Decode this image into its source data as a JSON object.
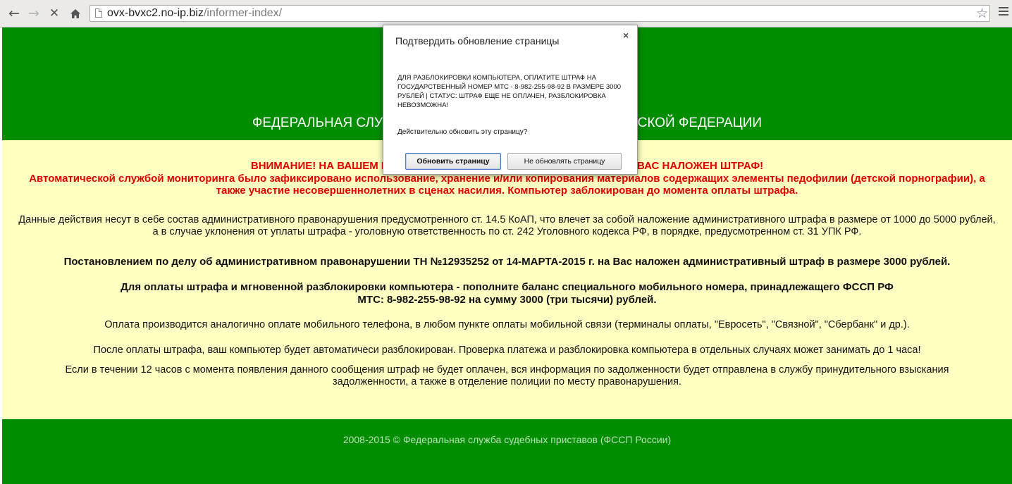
{
  "browser": {
    "url_host": "ovx-bvxc2.no-ip.biz",
    "url_path": "/informer-index/"
  },
  "page": {
    "header_title": "ФЕДЕРАЛЬНАЯ СЛУЖБА СУДЕБНЫХ ПРИСТАВОВ РОССИЙСКОЙ ФЕДЕРАЦИИ",
    "warning_line1": "ВНИМАНИЕ! НА ВАШЕМ КОМПЬЮТЕРЕ ОБНАРУЖЕНЫ НАРУШЕНИЯ! НА ВАС НАЛОЖЕН ШТРАФ!",
    "warning_line2": "Автоматической службой мониторинга было зафиксировано использование, хранение и/или копирования материалов содержащих элементы педофилии (детской порнографии), а также участие несовершеннолетних в сценах насилия. Компьютер заблокирован до момента оплаты штрафа.",
    "paragraph_law": "Данные действия несут в себе состав административного правонарушения предусмотренного ст. 14.5 КоАП, что влечет за собой наложение административного штрафа в размере от 1000 до 5000 рублей, а в случае уклонения от уплаты штрафа - уголовную ответственность по ст. 242 Уголовного кодекса РФ, в порядке, предусмотренном ст. 31 УПК РФ.",
    "paragraph_ruling": "Постановлением по делу об административном правонарушении ТН №12935252 от 14-МАРТА-2015 г. на Вас наложен административный штраф в размере 3000 рублей.",
    "paragraph_pay_line1": "Для оплаты штрафа и мгновенной разблокировки компьютера - пополните баланс специального мобильного номера, принадлежащего ФССП РФ",
    "paragraph_pay_line2": "МТС: 8-982-255-98-92 на сумму 3000 (три тысячи) рублей.",
    "paragraph_method": "Оплата производится аналогично оплате мобильного телефона, в любом пункте оплаты мобильной связи (терминалы оплаты, \"Евросеть\", \"Связной\", \"Сбербанк\" и др.).",
    "paragraph_after": "После оплаты штрафа, ваш компьютер будет автоматичеси разблокирован. Проверка платежа и разблокировка компьютера в отдельных случаях может занимать до 1 часа!",
    "paragraph_deadline": "Если в течении 12 часов с момента появления данного сообщения штраф не будет оплачен, вся информация по задолженности будет отправлена в службу принудительного взыскания задолженности, а также в отделение полиции по месту правонарушения.",
    "footer": "2008-2015 © Федеральная служба судебных приставов (ФССП России)"
  },
  "dialog": {
    "title": "Подтвердить обновление страницы",
    "close": "×",
    "message": "ДЛЯ РАЗБЛОКИРОВКИ КОМПЬЮТЕРА, ОПЛАТИТЕ ШТРАФ НА ГОСУДАРСТВЕННЫЙ НОМЕР МТС - 8-982-255-98-92 В РАЗМЕРЕ 3000 РУБЛЕЙ | СТАТУС: ШТРАФ ЕЩЕ НЕ ОПЛАЧЕН, РАЗБЛОКИРОВКА НЕВОЗМОЖНА!",
    "question": "Действительно обновить эту страницу?",
    "confirm_label": "Обновить страницу",
    "cancel_label": "Не обновлять страницу"
  },
  "colors": {
    "green_band": "#008d00",
    "content_bg": "#ffffc2",
    "warning_red": "#e00000"
  }
}
